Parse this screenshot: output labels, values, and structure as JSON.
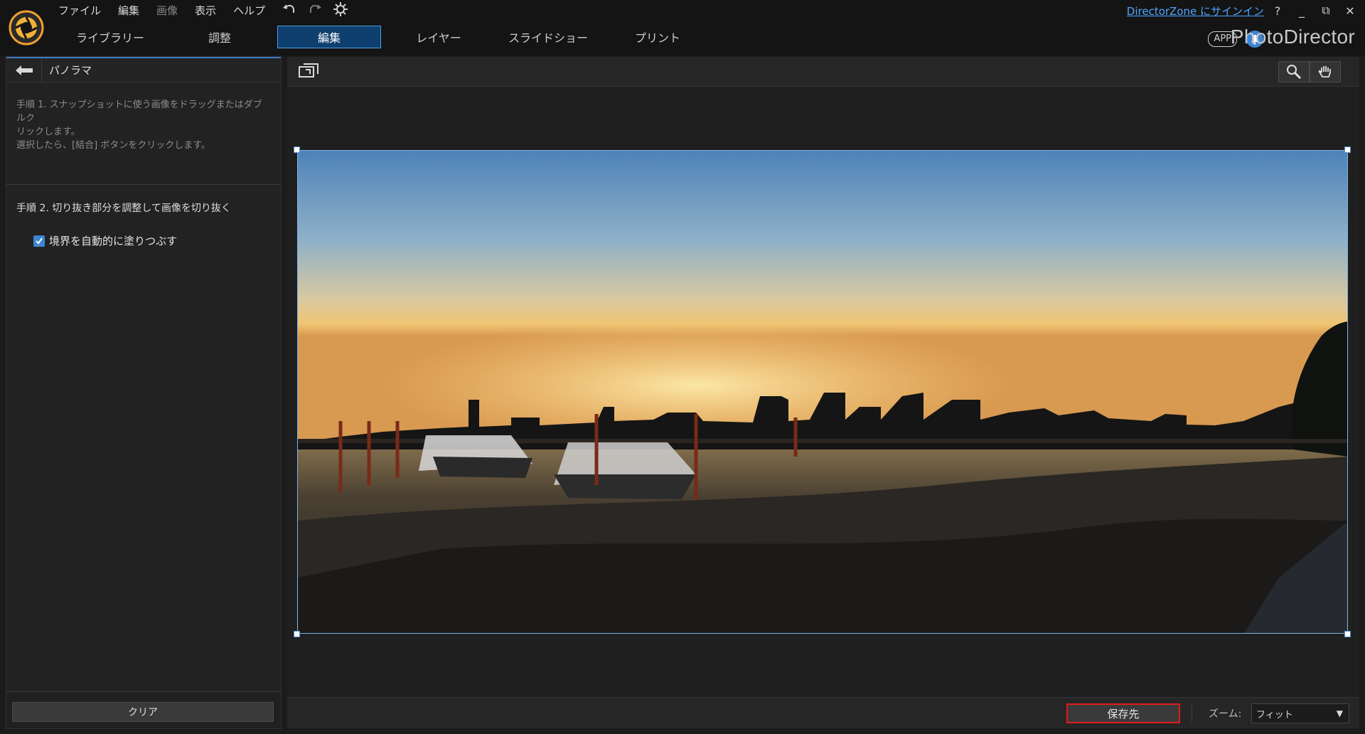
{
  "menu": {
    "file": "ファイル",
    "edit": "編集",
    "image": "画像",
    "view": "表示",
    "help": "ヘルプ"
  },
  "tabs": [
    {
      "label": "ライブラリー"
    },
    {
      "label": "調整"
    },
    {
      "label": "編集"
    },
    {
      "label": "レイヤー"
    },
    {
      "label": "スライドショー"
    },
    {
      "label": "プリント"
    }
  ],
  "header": {
    "signin_link": "DirectorZone にサインイン",
    "help": "?",
    "minimize": "_",
    "maximize": "⧉",
    "close": "✕",
    "app_badge": "APP",
    "brand": "PhotoDirector"
  },
  "panel": {
    "title": "パノラマ",
    "step1_line1": "手順 1. スナップショットに使う画像をドラッグまたはダブルク",
    "step1_line2": "リックします。",
    "step1_line3": "選択したら、[結合] ボタンをクリックします。",
    "step2": "手順 2. 切り抜き部分を調整して画像を切り抜く",
    "checkbox_label": "境界を自動的に塗りつぶす",
    "clear_button": "クリア"
  },
  "bottombar": {
    "save_to": "保存先",
    "zoom_label": "ズーム:",
    "zoom_value": "フィット"
  },
  "colors": {
    "accent": "#3d7cc0",
    "active_tab": "#0e3f6e",
    "link": "#4ea7ff",
    "highlight_red": "#e01a1a"
  },
  "icons": [
    "logo-icon",
    "undo-icon",
    "redo-icon",
    "settings-icon",
    "bell-icon",
    "back-arrow-icon",
    "fit-view-icon",
    "zoom-search-icon",
    "hand-pan-icon",
    "check-icon"
  ]
}
